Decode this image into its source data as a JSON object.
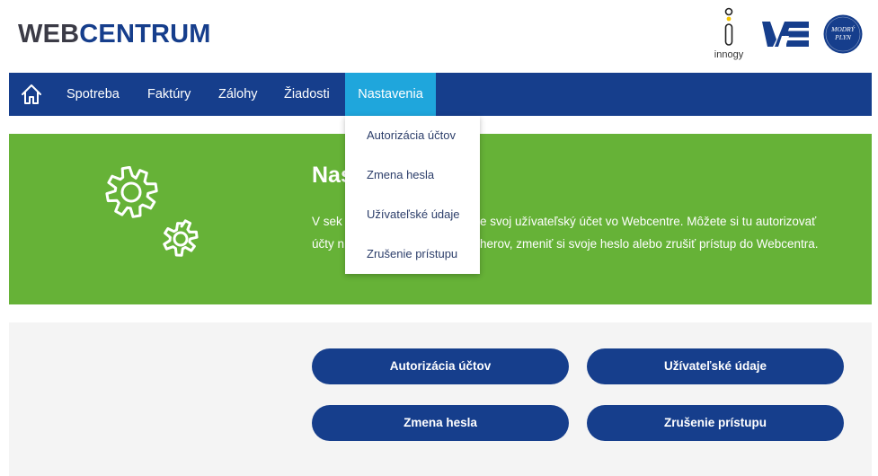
{
  "header": {
    "logo_part1": "WEB",
    "logo_part2": "CENTRUM",
    "brands": {
      "innogy_label": "innogy",
      "modry_line1": "MODRÝ",
      "modry_line2": "PLYN"
    }
  },
  "nav": {
    "home_icon": "home-icon",
    "items": [
      {
        "label": "Spotreba"
      },
      {
        "label": "Faktúry"
      },
      {
        "label": "Zálohy"
      },
      {
        "label": "Žiadosti"
      },
      {
        "label": "Nastavenia",
        "active": true
      }
    ]
  },
  "dropdown": {
    "items": [
      {
        "label": "Autorizácia účtov"
      },
      {
        "label": "Zmena hesla"
      },
      {
        "label": "Užívateľské údaje"
      },
      {
        "label": "Zrušenie prístupu"
      }
    ]
  },
  "hero": {
    "icon": "gears-icon",
    "title_visible": "Nas",
    "line1_left": "V sek",
    "line1_right": "e svoj užívateľský účet vo Webcentre. Môžete si tu autorizovať",
    "line2_left": "účty n",
    "line2_right": "herov, zmeniť si svoje heslo alebo zrušiť prístup do Webcentra."
  },
  "actions": {
    "autorizacia": "Autorizácia účtov",
    "udaje": "Užívateľské údaje",
    "heslo": "Zmena hesla",
    "zrusenie": "Zrušenie prístupu"
  },
  "colors": {
    "brand_blue": "#163e8c",
    "active_tab": "#1fa6dc",
    "hero_green": "#66b237",
    "panel_bg": "#f4f4f4"
  }
}
